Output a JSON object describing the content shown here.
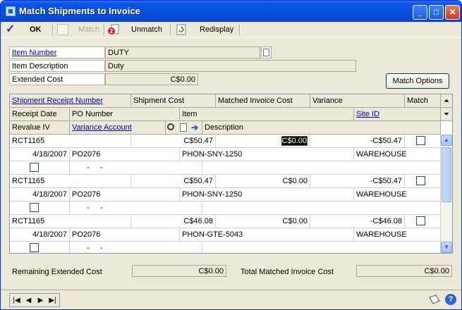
{
  "window": {
    "title": "Match Shipments to Invoice"
  },
  "toolbar": {
    "ok_label": "OK",
    "match_label": "Match",
    "unmatch_label": "Unmatch",
    "redisplay_label": "Redisplay"
  },
  "header": {
    "item_number_label": "Item Number",
    "item_number_value": "DUTY",
    "item_description_label": "Item Description",
    "item_description_value": "Duty",
    "extended_cost_label": "Extended Cost",
    "extended_cost_value": "C$0.00",
    "match_options_label": "Match Options"
  },
  "grid": {
    "headers": {
      "shipment_receipt_number": "Shipment Receipt Number",
      "shipment_cost": "Shipment Cost",
      "matched_invoice_cost": "Matched Invoice Cost",
      "variance": "Variance",
      "match": "Match",
      "receipt_date": "Receipt Date",
      "po_number": "PO Number",
      "item": "Item",
      "site_id": "Site ID",
      "revalue_iv": "Revalue IV",
      "variance_account": "Variance Account",
      "description": "Description"
    },
    "rows": [
      {
        "receipt": "RCT1165",
        "shipment_cost": "C$50.47",
        "matched_cost": "C$0.00",
        "variance": "-C$50.47",
        "date": "4/18/2007",
        "po": "PO2076",
        "item": "PHON-SNY-1250",
        "site": "WAREHOUSE",
        "account": "-     -"
      },
      {
        "receipt": "RCT1165",
        "shipment_cost": "C$50.47",
        "matched_cost": "C$0.00",
        "variance": "-C$50.47",
        "date": "4/18/2007",
        "po": "PO2076",
        "item": "PHON-SNY-1250",
        "site": "WAREHOUSE",
        "account": "-     -"
      },
      {
        "receipt": "RCT1165",
        "shipment_cost": "C$46.08",
        "matched_cost": "C$0.00",
        "variance": "-C$46.08",
        "date": "4/18/2007",
        "po": "PO2076",
        "item": "PHON-GTE-5043",
        "site": "WAREHOUSE",
        "account": "-     -"
      }
    ]
  },
  "footer": {
    "remaining_label": "Remaining Extended Cost",
    "remaining_value": "C$0.00",
    "total_matched_label": "Total Matched Invoice Cost",
    "total_matched_value": "C$0.00"
  },
  "colors": {
    "titlebar": "#0a4fdb",
    "window_bg": "#ece9d8",
    "link": "#0000cc"
  }
}
